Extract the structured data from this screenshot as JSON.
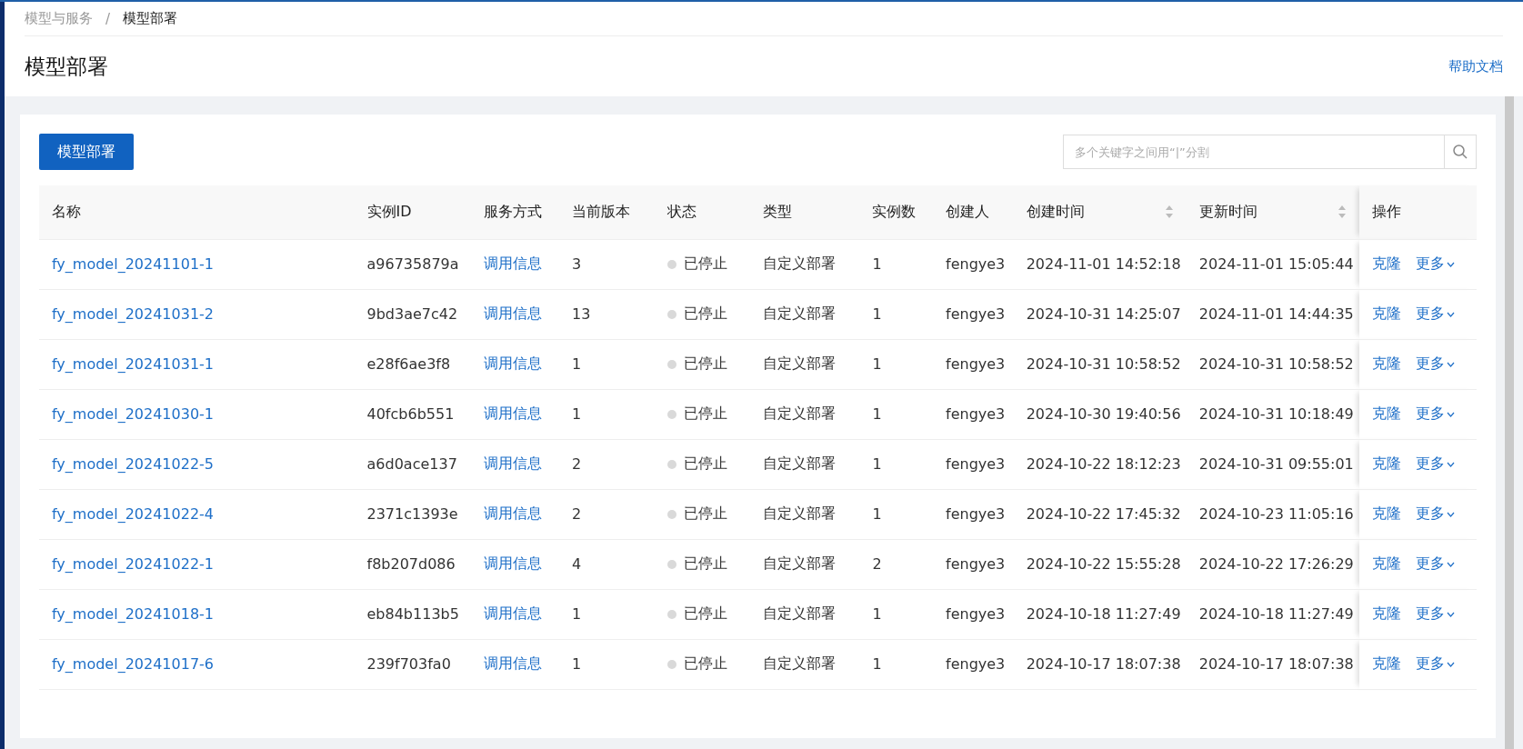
{
  "breadcrumb": [
    {
      "label": "模型与服务",
      "current": false
    },
    {
      "label": "模型部署",
      "current": true
    }
  ],
  "breadcrumb_separator": "/",
  "page_title": "模型部署",
  "help_link": "帮助文档",
  "deploy_button": "模型部署",
  "search": {
    "placeholder": "多个关键字之间用“|”分割"
  },
  "table": {
    "columns": [
      {
        "label": "名称",
        "sortable": false
      },
      {
        "label": "实例ID",
        "sortable": false
      },
      {
        "label": "服务方式",
        "sortable": false
      },
      {
        "label": "当前版本",
        "sortable": false
      },
      {
        "label": "状态",
        "sortable": false
      },
      {
        "label": "类型",
        "sortable": false
      },
      {
        "label": "实例数",
        "sortable": false
      },
      {
        "label": "创建人",
        "sortable": false
      },
      {
        "label": "创建时间",
        "sortable": true
      },
      {
        "label": "更新时间",
        "sortable": true
      },
      {
        "label": "操作",
        "sortable": false
      }
    ],
    "rows": [
      {
        "name": "fy_model_20241101-1",
        "instance_id": "a96735879a",
        "service": "调用信息",
        "version": "3",
        "status": "已停止",
        "color": "#d9d9d9",
        "type": "自定义部署",
        "instances": "1",
        "creator": "fengye3",
        "created": "2024-11-01 14:52:18",
        "updated": "2024-11-01 15:05:44",
        "actions": [
          "克隆",
          "更多"
        ]
      },
      {
        "name": "fy_model_20241031-2",
        "instance_id": "9bd3ae7c42",
        "service": "调用信息",
        "version": "13",
        "status": "已停止",
        "color": "#d9d9d9",
        "type": "自定义部署",
        "instances": "1",
        "creator": "fengye3",
        "created": "2024-10-31 14:25:07",
        "updated": "2024-11-01 14:44:35",
        "actions": [
          "克隆",
          "更多"
        ]
      },
      {
        "name": "fy_model_20241031-1",
        "instance_id": "e28f6ae3f8",
        "service": "调用信息",
        "version": "1",
        "status": "已停止",
        "color": "#d9d9d9",
        "type": "自定义部署",
        "instances": "1",
        "creator": "fengye3",
        "created": "2024-10-31 10:58:52",
        "updated": "2024-10-31 10:58:52",
        "actions": [
          "克隆",
          "更多"
        ]
      },
      {
        "name": "fy_model_20241030-1",
        "instance_id": "40fcb6b551",
        "service": "调用信息",
        "version": "1",
        "status": "已停止",
        "color": "#d9d9d9",
        "type": "自定义部署",
        "instances": "1",
        "creator": "fengye3",
        "created": "2024-10-30 19:40:56",
        "updated": "2024-10-31 10:18:49",
        "actions": [
          "克隆",
          "更多"
        ]
      },
      {
        "name": "fy_model_20241022-5",
        "instance_id": "a6d0ace137",
        "service": "调用信息",
        "version": "2",
        "status": "已停止",
        "color": "#d9d9d9",
        "type": "自定义部署",
        "instances": "1",
        "creator": "fengye3",
        "created": "2024-10-22 18:12:23",
        "updated": "2024-10-31 09:55:01",
        "actions": [
          "克隆",
          "更多"
        ]
      },
      {
        "name": "fy_model_20241022-4",
        "instance_id": "2371c1393e",
        "service": "调用信息",
        "version": "2",
        "status": "已停止",
        "color": "#d9d9d9",
        "type": "自定义部署",
        "instances": "1",
        "creator": "fengye3",
        "created": "2024-10-22 17:45:32",
        "updated": "2024-10-23 11:05:16",
        "actions": [
          "克隆",
          "更多"
        ]
      },
      {
        "name": "fy_model_20241022-1",
        "instance_id": "f8b207d086",
        "service": "调用信息",
        "version": "4",
        "status": "已停止",
        "color": "#d9d9d9",
        "type": "自定义部署",
        "instances": "2",
        "creator": "fengye3",
        "created": "2024-10-22 15:55:28",
        "updated": "2024-10-22 17:26:29",
        "actions": [
          "克隆",
          "更多"
        ]
      },
      {
        "name": "fy_model_20241018-1",
        "instance_id": "eb84b113b5",
        "service": "调用信息",
        "version": "1",
        "status": "已停止",
        "color": "#d9d9d9",
        "type": "自定义部署",
        "instances": "1",
        "creator": "fengye3",
        "created": "2024-10-18 11:27:49",
        "updated": "2024-10-18 11:27:49",
        "actions": [
          "克隆",
          "更多"
        ]
      },
      {
        "name": "fy_model_20241017-6",
        "instance_id": "239f703fa0",
        "service": "调用信息",
        "version": "1",
        "status": "已停止",
        "color": "#d9d9d9",
        "type": "自定义部署",
        "instances": "1",
        "creator": "fengye3",
        "created": "2024-10-17 18:07:38",
        "updated": "2024-10-17 18:07:38",
        "actions": [
          "克隆",
          "更多"
        ]
      }
    ]
  }
}
